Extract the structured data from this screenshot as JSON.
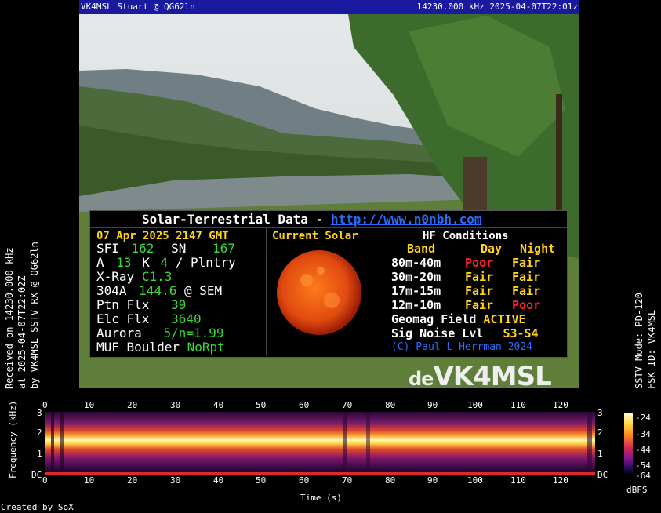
{
  "header": {
    "left": "VK4MSL Stuart @ QG62ln",
    "right": "14230.000 kHz 2025-04-07T22:01z"
  },
  "solar_panel": {
    "title_prefix": "Solar-Terrestrial Data - ",
    "title_url": "http://www.n0nbh.com",
    "date": "07 Apr 2025 2147 GMT",
    "sfi_label": "SFI",
    "sfi_value": "162",
    "sn_label": "SN",
    "sn_value": "167",
    "a_label": "A",
    "a_value": "13",
    "k_label": "K",
    "k_value": "4",
    "k_suffix": "/ Plntry",
    "xray_label": "X-Ray",
    "xray_value": "C1.3",
    "a304_label": "304A",
    "a304_value": "144.6",
    "a304_suffix": "@ SEM",
    "ptn_label": "Ptn Flx",
    "ptn_value": "39",
    "elc_label": "Elc Flx",
    "elc_value": "3640",
    "aurora_label": "Aurora",
    "aurora_value": "5/n=1.99",
    "muf_label": "MUF Boulder",
    "muf_value": "NoRpt",
    "current_solar": "Current Solar",
    "hf_title": "HF Conditions",
    "hf_headers": [
      "Band",
      "Day",
      "Night"
    ],
    "hf_rows": [
      {
        "band": "80m-40m",
        "day": "Poor",
        "night": "Fair"
      },
      {
        "band": "30m-20m",
        "day": "Fair",
        "night": "Fair"
      },
      {
        "band": "17m-15m",
        "day": "Fair",
        "night": "Fair"
      },
      {
        "band": "12m-10m",
        "day": "Fair",
        "night": "Poor"
      }
    ],
    "geomag_label": "Geomag Field",
    "geomag_value": "ACTIVE",
    "noise_label": "Sig Noise Lvl",
    "noise_value": "S3-S4",
    "copyright": "(C) Paul L Herrman 2024"
  },
  "brand": {
    "de": "de",
    "call": "VK4MSL"
  },
  "left_caption": [
    "Received on 14230.000 kHz",
    "at 2025-04-07T22:02Z",
    "by VK4MSL SSTV RX @ QG62ln"
  ],
  "right_caption": [
    "SSTV Mode: PD-120",
    "FSK ID: VK4MSL"
  ],
  "spectrogram": {
    "ylabel": "Frequency (kHz)",
    "xlabel": "Time (s)",
    "x_ticks": [
      "0",
      "10",
      "20",
      "30",
      "40",
      "50",
      "60",
      "70",
      "80",
      "90",
      "100",
      "110",
      "120"
    ],
    "y_ticks": [
      "3",
      "2",
      "1",
      "DC"
    ],
    "cbar_ticks": [
      "-24",
      "-34",
      "-44",
      "-54",
      "-64"
    ],
    "cbar_label": "dBFS",
    "credit": "Created by SoX"
  },
  "colors": {
    "header_bg": "#1a1aa0",
    "good": "#39d83a",
    "value": "#ffd21a",
    "poor": "#ff2020",
    "link": "#2a6bff"
  }
}
